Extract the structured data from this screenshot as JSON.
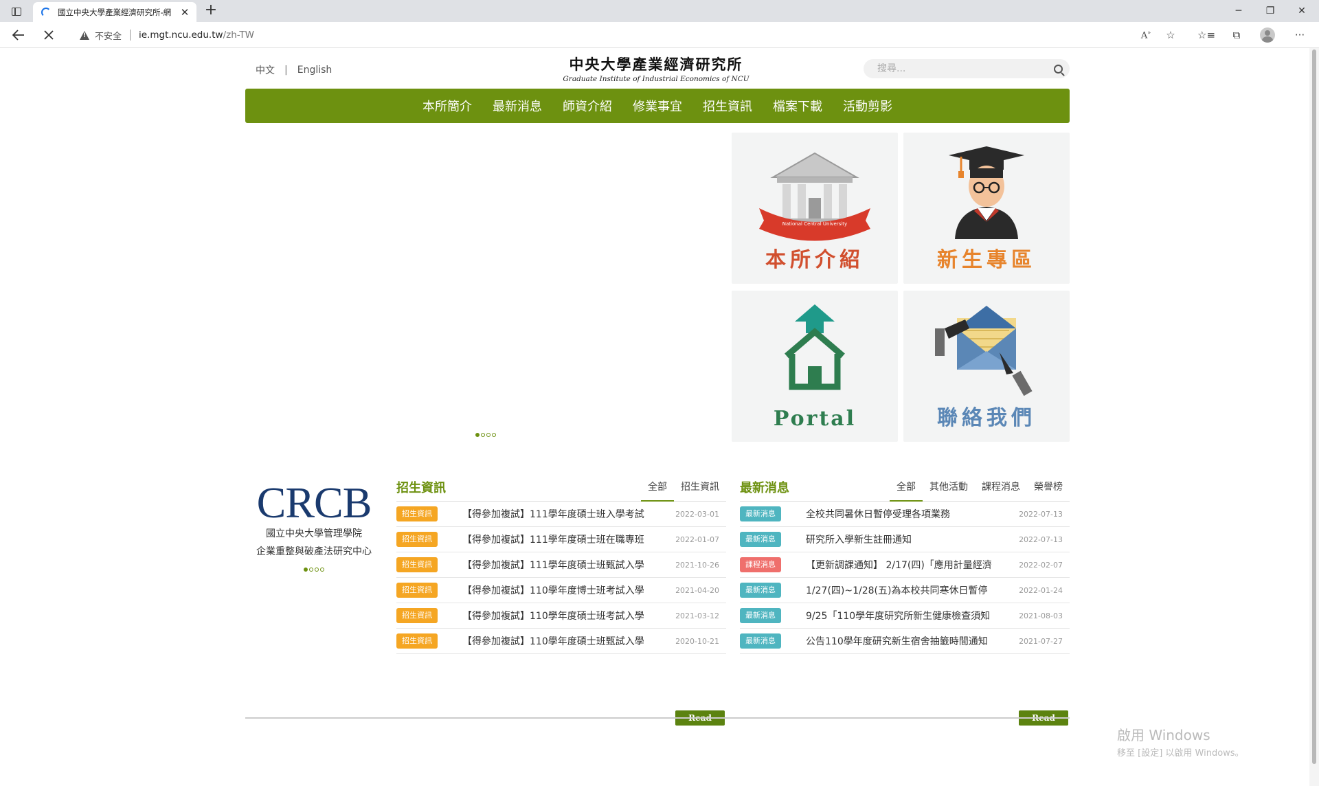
{
  "browser": {
    "tab_title": "國立中央大學產業經濟研究所-網",
    "tab_close": "✕",
    "new_tab": "+",
    "security_label": "不安全",
    "url_host": "ie.mgt.ncu.edu.tw",
    "url_path": "/zh-TW",
    "window_controls": [
      "─",
      "❐",
      "✕"
    ],
    "toolbar_icons": [
      "read-aloud-icon",
      "favorite-star-icon",
      "favorites-icon",
      "collections-icon",
      "profile-icon",
      "more-icon"
    ]
  },
  "header": {
    "lang_zh": "中文",
    "lang_sep": "|",
    "lang_en": "English",
    "logo_zh": "中央大學產業經濟研究所",
    "logo_en": "Graduate Institute of Industrial Economics of NCU",
    "search_placeholder": "搜尋..."
  },
  "nav": [
    "本所簡介",
    "最新消息",
    "師資介紹",
    "修業事宜",
    "招生資訊",
    "檔案下載",
    "活動剪影"
  ],
  "tiles": {
    "about": "本所介紹",
    "freshman": "新生專區",
    "portal": "Portal",
    "contact": "聯絡我們",
    "banner_text": "National Central University"
  },
  "colors": {
    "brand_green": "#6d9110",
    "tile_red": "#d14f2e",
    "tile_orange": "#e7842c",
    "tile_green": "#2e7d4f",
    "tile_blue": "#5b87b6"
  },
  "crcb": {
    "logo": "CRCB",
    "line1": "國立中央大學管理學院",
    "line2": "企業重整與破產法研究中心"
  },
  "admissions": {
    "title": "招生資訊",
    "tabs": [
      "全部",
      "招生資訊"
    ],
    "read_more": "Read More",
    "rows": [
      {
        "badge": "招生資訊",
        "text": "【得參加複試】111學年度碩士班入學考試",
        "date": "2022-03-01"
      },
      {
        "badge": "招生資訊",
        "text": "【得參加複試】111學年度碩士班在職專班",
        "date": "2022-01-07"
      },
      {
        "badge": "招生資訊",
        "text": "【得參加複試】111學年度碩士班甄試入學",
        "date": "2021-10-26"
      },
      {
        "badge": "招生資訊",
        "text": "【得參加複試】110學年度博士班考試入學",
        "date": "2021-04-20"
      },
      {
        "badge": "招生資訊",
        "text": "【得參加複試】110學年度碩士班考試入學",
        "date": "2021-03-12"
      },
      {
        "badge": "招生資訊",
        "text": "【得參加複試】110學年度碩士班甄試入學",
        "date": "2020-10-21"
      }
    ]
  },
  "latest": {
    "title": "最新消息",
    "tabs": [
      "全部",
      "其他活動",
      "課程消息",
      "榮譽榜"
    ],
    "read_more": "Read More",
    "rows": [
      {
        "badge": "最新消息",
        "kind": "teal",
        "text": "全校共同暑休日暫停受理各項業務",
        "date": "2022-07-13"
      },
      {
        "badge": "最新消息",
        "kind": "teal",
        "text": "研究所入學新生註冊通知",
        "date": "2022-07-13"
      },
      {
        "badge": "課程消息",
        "kind": "red",
        "text": "【更新調課通知】 2/17(四)「應用計量經濟",
        "date": "2022-02-07"
      },
      {
        "badge": "最新消息",
        "kind": "teal",
        "text": "1/27(四)~1/28(五)為本校共同寒休日暫停",
        "date": "2022-01-24"
      },
      {
        "badge": "最新消息",
        "kind": "teal",
        "text": "9/25「110學年度研究所新生健康檢查須知",
        "date": "2021-08-03"
      },
      {
        "badge": "最新消息",
        "kind": "teal",
        "text": "公告110學年度研究新生宿舍抽籤時間通知",
        "date": "2021-07-27"
      }
    ]
  },
  "watermark": {
    "line1": "啟用 Windows",
    "line2": "移至 [設定] 以啟用 Windows。"
  }
}
